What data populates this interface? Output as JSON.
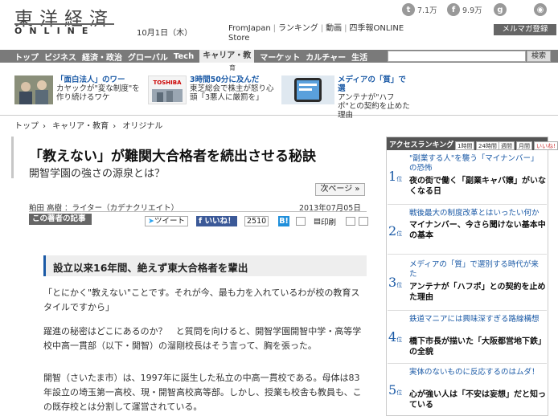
{
  "header": {
    "logo_jp": "東洋経済",
    "logo_en": "ONLINE",
    "date": "10月1日（木）",
    "links": [
      "FromJapan",
      "ランキング",
      "動画",
      "四季報ONLINE",
      "Store"
    ],
    "signup": "メルマガ登録",
    "social": [
      {
        "icon": "twitter-icon",
        "glyph": "t",
        "count": "7.1万"
      },
      {
        "icon": "facebook-icon",
        "glyph": "f",
        "count": "9.9万"
      },
      {
        "icon": "google-plus-icon",
        "glyph": "g",
        "count": ""
      },
      {
        "icon": "rss-icon",
        "glyph": "◉",
        "count": ""
      }
    ]
  },
  "nav": {
    "items": [
      "トップ",
      "ビジネス",
      "経済・政治",
      "グローバル",
      "Tech",
      "キャリア・教",
      "マーケット",
      "カルチャー",
      "生活"
    ],
    "active_index": 5,
    "search_button": "検索",
    "subnav": "育"
  },
  "promo": [
    {
      "headline": "「面白法人」のワー",
      "body": "カヤックが\"変な制度\"を作り続けるワケ"
    },
    {
      "headline": "3時間50分に及んだ",
      "body": "東芝総会で株主が怒り心頭「3悪人に厳罰を」"
    },
    {
      "headline": "メディアの「質」で選",
      "body": "アンテナが\"ハフポ\"との契約を止めた理由"
    }
  ],
  "promo_brand": "TOSHIBA",
  "breadcrumb": [
    "トップ",
    "キャリア・教育",
    "オリジナル"
  ],
  "article": {
    "title": "「教えない」が難関大合格者を続出させる秘訣",
    "subtitle": "開智学園の強さの源泉とは？",
    "next_page": "次ページ »",
    "author": "粕田 高樹 ：ライター（カデナクリエイト）",
    "pubdate": "2013年07月05日",
    "author_articles": "この著者の記事",
    "tweet": "ツイート",
    "like": "いいね！",
    "like_count": "2510",
    "hatena": "B!",
    "print": "印刷",
    "heading": "設立以来16年間、絶えず東大合格者を輩出",
    "paragraphs": [
      "「とにかく\"教えない\"ことです。それが今、最も力を入れているわが校の教育スタイルですから」",
      "躍進の秘密はどこにあるのか？　と質問を向けると、開智学園開智中学・高等学校中高一貫部（以下・開智）の溜剛校長はそう言って、胸を張った。",
      "開智（さいたま市）は、1997年に誕生した私立の中高一貫校である。母体は83年設立の埼玉第一高校、現・開智高校高等部。しかし、授業も校舎も教員も、この既存校とは分割して運営されている。"
    ]
  },
  "ranking": {
    "title": "アクセスランキング",
    "tabs": [
      "1時間",
      "24時間",
      "週間",
      "月間",
      "いいね!"
    ],
    "items": [
      {
        "rank": "1",
        "suffix": "位",
        "sub": "\"副業する人\"を襲う「マイナンバー」の恐怖",
        "title": "夜の街で働く「副業キャバ嬢」がいなくなる日"
      },
      {
        "rank": "2",
        "suffix": "位",
        "sub": "戦後最大の制度改革とはいったい何か",
        "title": "マイナンバー、今さら聞けない基本中の基本"
      },
      {
        "rank": "3",
        "suffix": "位",
        "sub": "メディアの「質」で選別する時代が来た",
        "title": "アンテナが「ハフポ」との契約を止めた理由"
      },
      {
        "rank": "4",
        "suffix": "位",
        "sub": "鉄道マニアには興味深すぎる路線構想",
        "title": "橋下市長が描いた「大阪都営地下鉄」の全貌"
      },
      {
        "rank": "5",
        "suffix": "位",
        "sub": "実体のないものに反応するのはムダ！",
        "title": "心が強い人は「不安は妄想」だと知っている"
      }
    ]
  },
  "colors": {
    "accent": "#1b5aa6",
    "nav": "#7a7a7a",
    "facebook": "#3b5998"
  }
}
